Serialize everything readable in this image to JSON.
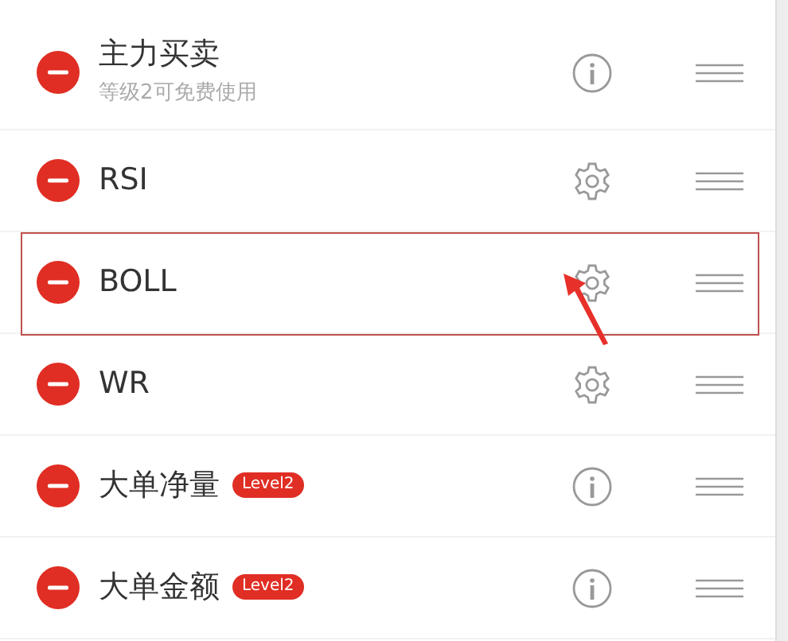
{
  "indicators": [
    {
      "name": "主力买卖",
      "subtitle": "等级2可免费使用",
      "kind": "info",
      "highlighted": false
    },
    {
      "name": "RSI",
      "kind": "settings",
      "highlighted": false
    },
    {
      "name": "BOLL",
      "kind": "settings",
      "highlighted": true
    },
    {
      "name": "WR",
      "kind": "settings",
      "highlighted": false
    },
    {
      "name": "大单净量",
      "badge": "Level2",
      "kind": "info",
      "highlighted": false
    },
    {
      "name": "大单金额",
      "badge": "Level2",
      "kind": "info",
      "highlighted": false
    }
  ]
}
